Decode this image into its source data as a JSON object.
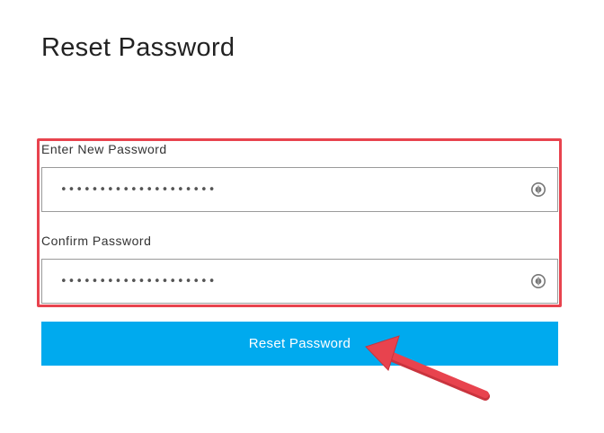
{
  "page": {
    "title": "Reset Password"
  },
  "form": {
    "new_password": {
      "label": "Enter New Password",
      "value": "••••••••••••••••••••",
      "toggle_icon": "eye-toggle-icon"
    },
    "confirm_password": {
      "label": "Confirm Password",
      "value": "••••••••••••••••••••",
      "toggle_icon": "eye-toggle-icon"
    },
    "submit_label": "Reset Password"
  },
  "annotations": {
    "highlight_color": "#e8434e",
    "arrow_color": "#e8434e"
  },
  "colors": {
    "button_bg": "#00aaee",
    "button_text": "#ffffff"
  }
}
